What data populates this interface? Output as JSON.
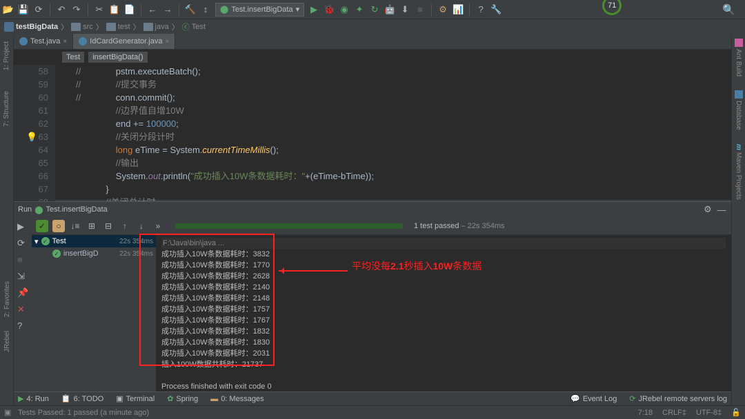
{
  "toolbar": {
    "run_config": "Test.insertBigData",
    "score": "71"
  },
  "breadcrumb": {
    "items": [
      "testBigData",
      "src",
      "test",
      "java",
      "Test"
    ]
  },
  "left_tabs": {
    "project": "1: Project",
    "structure": "7: Structure"
  },
  "right_tabs": {
    "ant": "Ant Build",
    "database": "Database",
    "maven": "Maven Projects"
  },
  "fav_tab": "2: Favorites",
  "jrebel_tab": "JRebel",
  "editor_tabs": {
    "t1": "Test.java",
    "t2": "IdCardGenerator.java"
  },
  "nav": {
    "class": "Test",
    "method": "insertBigData()"
  },
  "code": {
    "lines": [
      {
        "n": "58",
        "indent": "            //",
        "body_cm": "提交事务",
        "pre": "pstm.executeBatch();"
      },
      {
        "n": "59",
        "indent": "            //",
        "body": "conn.commit();"
      },
      {
        "n": "60",
        "indent": "            //",
        "body": ""
      },
      {
        "n": "61",
        "cm": "//边界值自增10W"
      },
      {
        "n": "62",
        "stmt_end": "end += 100000;"
      },
      {
        "n": "63",
        "cm": "//关闭分段计时"
      },
      {
        "n": "64",
        "long_stmt": "long eTime = System.currentTimeMillis();"
      },
      {
        "n": "65",
        "cm": "//输出"
      },
      {
        "n": "66",
        "println": "System.out.println(\"成功插入10W条数据耗时：\"+(eTime-bTime));"
      },
      {
        "n": "67",
        "brace": "}"
      },
      {
        "n": "68",
        "cm": "//关闭总计时"
      }
    ]
  },
  "run": {
    "title_prefix": "Run",
    "title": "Test.insertBigData",
    "status_pass": "1 test passed",
    "status_time": "– 22s 354ms",
    "tree": {
      "root": "Test",
      "root_time": "22s 354ms",
      "child": "insertBigD",
      "child_time": "22s 354ms"
    },
    "console": {
      "header": "F:\\Java\\bin\\java ...",
      "lines": [
        "成功插入10W条数据耗时：3832",
        "成功插入10W条数据耗时：1770",
        "成功插入10W条数据耗时：2628",
        "成功插入10W条数据耗时：2140",
        "成功插入10W条数据耗时：2148",
        "成功插入10W条数据耗时：1757",
        "成功插入10W条数据耗时：1767",
        "成功插入10W条数据耗时：1832",
        "成功插入10W条数据耗时：1830",
        "成功插入10W条数据耗时：2031",
        "插入100W数据共耗时：21737"
      ],
      "exit": "Process finished with exit code 0"
    }
  },
  "annotation": "平均没每2.1秒插入10W条数据",
  "bottom_tabs": {
    "run": "4: Run",
    "todo": "6: TODO",
    "terminal": "Terminal",
    "spring": "Spring",
    "messages": "0: Messages",
    "event_log": "Event Log",
    "jrebel": "JRebel remote servers log"
  },
  "status_bar": {
    "msg": "Tests Passed: 1 passed (a minute ago)",
    "pos": "7:18",
    "sep": "CRLF",
    "enc": "UTF-8"
  }
}
